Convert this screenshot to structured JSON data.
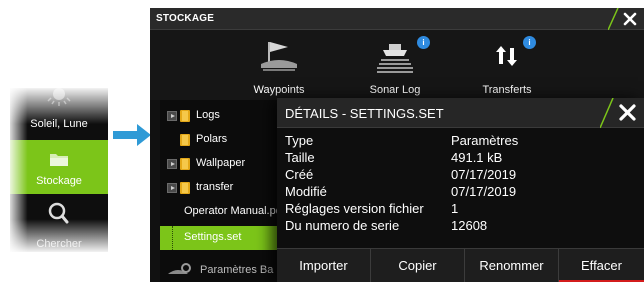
{
  "side_menu": {
    "items": [
      {
        "label": "Soleil, Lune",
        "icon": "sun-moon-icon"
      },
      {
        "label": "Stockage",
        "icon": "folder-icon",
        "selected": true
      },
      {
        "label": "Chercher",
        "icon": "search-icon"
      }
    ]
  },
  "window": {
    "title": "STOCKAGE",
    "toolbar": [
      {
        "label": "Waypoints",
        "icon": "waypoint-flag-icon"
      },
      {
        "label": "Sonar Log",
        "icon": "sonar-log-icon",
        "badge": "i"
      },
      {
        "label": "Transferts",
        "icon": "transfer-arrows-icon",
        "badge": "i"
      }
    ],
    "files": [
      {
        "name": "Logs",
        "type": "folder",
        "expandable": true
      },
      {
        "name": "Polars",
        "type": "folder",
        "expandable": false
      },
      {
        "name": "Wallpaper",
        "type": "folder",
        "expandable": true
      },
      {
        "name": "transfer",
        "type": "folder",
        "expandable": true
      },
      {
        "name": "Operator Manual.pdf",
        "type": "file"
      },
      {
        "name": "Settings.set",
        "type": "file",
        "selected": true
      }
    ],
    "bottom_item": "Paramètres Ba"
  },
  "details": {
    "title": "DÉTAILS - SETTINGS.SET",
    "rows": [
      {
        "key": "Type",
        "value": "Paramètres"
      },
      {
        "key": "Taille",
        "value": "491.1 kB"
      },
      {
        "key": "Créé",
        "value": "07/17/2019"
      },
      {
        "key": "Modifié",
        "value": "07/17/2019"
      },
      {
        "key": "Réglages version fichier",
        "value": "1"
      },
      {
        "key": "Du numero de serie",
        "value": "12608"
      }
    ],
    "buttons": {
      "import": "Importer",
      "copy": "Copier",
      "rename": "Renommer",
      "delete": "Effacer"
    }
  },
  "colors": {
    "accent_green": "#7cc519",
    "badge_blue": "#2f8be0",
    "delete_red": "#d31c1c",
    "dialog_bg": "#0e0e0e"
  }
}
